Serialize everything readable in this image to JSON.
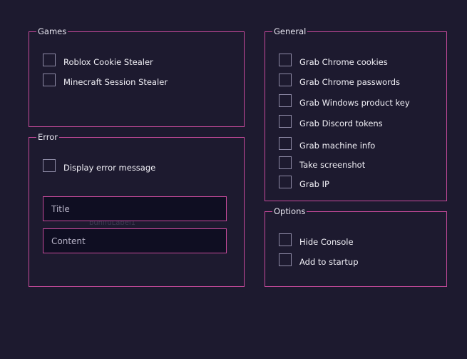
{
  "groups": {
    "games": {
      "title": "Games",
      "items": [
        "Roblox Cookie Stealer",
        "Minecraft Session Stealer"
      ]
    },
    "error": {
      "title": "Error",
      "display_error_label": "Display error message",
      "title_placeholder": "Title",
      "content_placeholder": "Content",
      "overlay_text": "bunifuLabel1"
    },
    "general": {
      "title": "General",
      "items": [
        "Grab Chrome cookies",
        "Grab Chrome passwords",
        "Grab Windows product key",
        "Grab Discord tokens",
        "Grab machine info",
        "Take screenshot",
        "Grab IP"
      ]
    },
    "options": {
      "title": "Options",
      "items": [
        "Hide Console",
        "Add to startup"
      ]
    }
  },
  "colors": {
    "background": "#1d1a2f",
    "accent": "#c64a9b",
    "input_background": "#0f0e22"
  }
}
